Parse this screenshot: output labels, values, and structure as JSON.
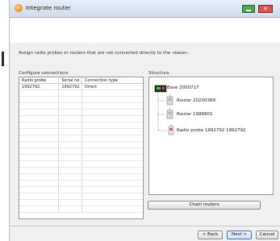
{
  "window": {
    "title": "Integrate router",
    "close_label": "✕"
  },
  "instruction": "Assign radio probes or routers that are not connected directly to the «base».",
  "configure": {
    "label": "Configure connections",
    "columns": [
      "Radio probe",
      "Serial no.",
      "Connection type"
    ],
    "rows": [
      {
        "probe": "1992792",
        "serial": "1992792",
        "type": "Direct"
      }
    ]
  },
  "structure": {
    "label": "Structure",
    "nodes": [
      {
        "label": "Base 2050717",
        "icon": "base-device-icon"
      },
      {
        "label": "Router 20200389",
        "icon": "router-icon"
      },
      {
        "label": "Router 1996801",
        "icon": "router-icon"
      },
      {
        "label": "Radio probe 1992792 1992792",
        "icon": "radio-probe-icon"
      }
    ]
  },
  "buttons": {
    "chain_routers": "Chain routers",
    "back": "< Back",
    "next": "Next >",
    "cancel": "Cancel"
  },
  "colors": {
    "titlebar": "#cfdcec",
    "minimize": "#4aa64a",
    "close": "#d9534f",
    "next_border": "#3b79c2"
  }
}
